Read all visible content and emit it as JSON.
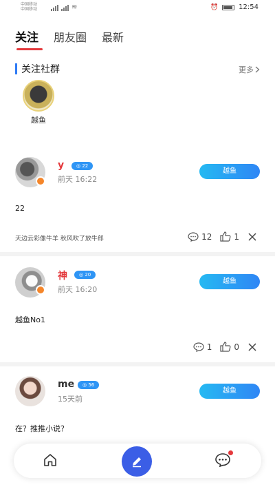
{
  "status_bar": {
    "carrier_1": "中国移动",
    "carrier_2": "中国移动",
    "time": "12:54"
  },
  "tabs": [
    {
      "label": "关注",
      "active": true
    },
    {
      "label": "朋友圈",
      "active": false
    },
    {
      "label": "最新",
      "active": false
    }
  ],
  "followed_communities": {
    "title": "关注社群",
    "more_label": "更多",
    "items": [
      {
        "name": "越鱼"
      }
    ]
  },
  "posts": [
    {
      "username": "y",
      "username_color": "#e4393c",
      "level": "22",
      "time": "前天 16:22",
      "group_label": "越鱼",
      "content": "22",
      "tags": "天边云彩像牛羊 秋风吹了放牛郎",
      "comments": "12",
      "likes": "1"
    },
    {
      "username": "神",
      "username_color": "#e4393c",
      "level": "20",
      "time": "前天 16:20",
      "group_label": "越鱼",
      "content": "越鱼No1",
      "comments": "1",
      "likes": "0"
    },
    {
      "username": "me",
      "username_color": "#333333",
      "level": "56",
      "time": "15天前",
      "group_label": "越鱼",
      "content": "在？推推小说？"
    }
  ],
  "bottom_nav": {
    "items": [
      "home-icon",
      "compose-icon",
      "message-icon"
    ],
    "has_unread_message": true
  },
  "colors": {
    "accent_red": "#e4393c",
    "accent_blue": "#2f86f5",
    "compose_blue": "#3b5ee6"
  }
}
